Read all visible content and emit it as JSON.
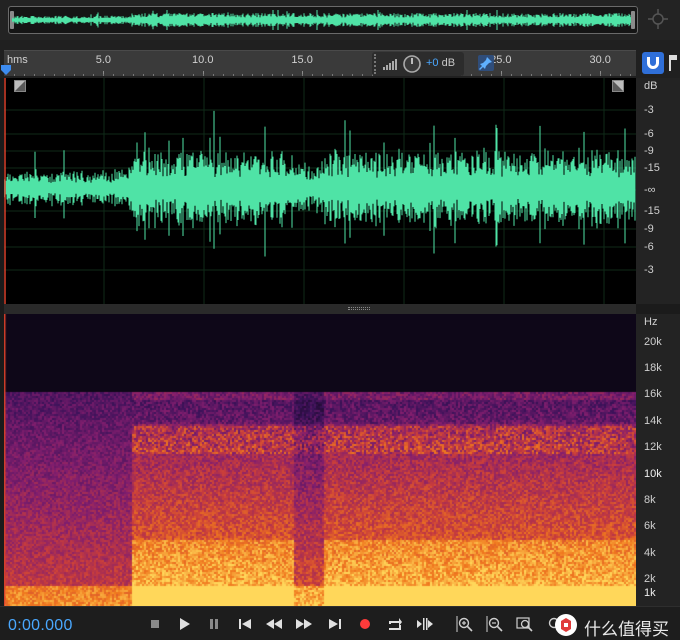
{
  "colors": {
    "accent_blue": "#4aa8ff",
    "waveform": "#4fe3a6",
    "record_red": "#ff3b3b",
    "snap_blue": "#2f6fd8"
  },
  "ruler": {
    "unit_label": "hms",
    "ticks": [
      {
        "seconds": 5.0,
        "label": "5.0"
      },
      {
        "seconds": 10.0,
        "label": "10.0"
      },
      {
        "seconds": 15.0,
        "label": "15.0"
      },
      {
        "seconds": 25.0,
        "label": "25.0"
      },
      {
        "seconds": 30.0,
        "label": "30.0"
      }
    ],
    "visible_seconds": 31.8
  },
  "hud": {
    "volume_value": "+0",
    "volume_unit": "dB"
  },
  "waveform_scale": {
    "unit": "dB",
    "labels": [
      "-3",
      "-6",
      "-9",
      "-15",
      "-∞",
      "-15",
      "-9",
      "-6",
      "-3"
    ]
  },
  "spectrogram_scale": {
    "unit": "Hz",
    "labels": [
      {
        "label": "20k",
        "hz": 20000
      },
      {
        "label": "18k",
        "hz": 18000
      },
      {
        "label": "16k",
        "hz": 16000
      },
      {
        "label": "14k",
        "hz": 14000
      },
      {
        "label": "12k",
        "hz": 12000
      },
      {
        "label": "10k",
        "hz": 10000
      },
      {
        "label": "8k",
        "hz": 8000
      },
      {
        "label": "6k",
        "hz": 6000
      },
      {
        "label": "4k",
        "hz": 4000
      },
      {
        "label": "2k",
        "hz": 2000
      },
      {
        "label": "1k",
        "hz": 1000
      }
    ]
  },
  "transport": {
    "time": "0:00.000",
    "buttons": [
      "stop-icon",
      "play-icon",
      "pause-icon",
      "skip-to-start-icon",
      "rewind-icon",
      "fast-forward-icon",
      "skip-to-end-icon",
      "record-icon",
      "loop-icon",
      "skip-selection-icon",
      "zoom-in-amplitude-icon",
      "zoom-out-amplitude-icon",
      "zoom-selection-icon",
      "zoom-in-time-icon"
    ]
  },
  "watermark": {
    "text": "什么值得买"
  }
}
